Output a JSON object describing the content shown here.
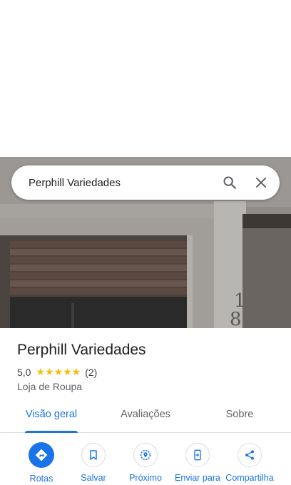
{
  "search": {
    "query": "Perphill Variedades"
  },
  "place": {
    "name": "Perphill Variedades",
    "rating": "5,0",
    "stars": "★★★★★",
    "review_count": "(2)",
    "category": "Loja de Roupa",
    "photo_alt": "Fachada de loja com portão de madeira e número 18"
  },
  "tabs": [
    {
      "label": "Visão geral",
      "active": true
    },
    {
      "label": "Avaliações",
      "active": false
    },
    {
      "label": "Sobre",
      "active": false
    }
  ],
  "actions": [
    {
      "label": "Rotas",
      "icon": "directions-icon"
    },
    {
      "label": "Salvar",
      "icon": "bookmark-icon"
    },
    {
      "label": "Próximo",
      "icon": "nearby-icon"
    },
    {
      "label": "Enviar para",
      "icon": "send-to-phone-icon"
    },
    {
      "label": "Compartilha",
      "icon": "share-icon"
    }
  ],
  "colors": {
    "accent": "#1a73e8",
    "star": "#fbbc04",
    "text": "#202124",
    "muted": "#5f6368"
  }
}
